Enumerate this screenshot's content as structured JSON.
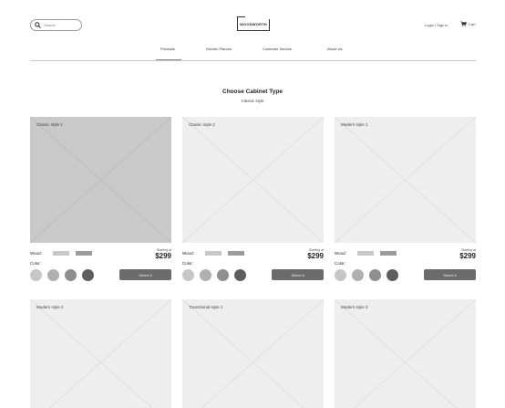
{
  "header": {
    "search_placeholder": "Search",
    "logo_text": "WOODWORTH",
    "login_label": "Login / Sign in",
    "cart_label": "Cart"
  },
  "nav": {
    "items": [
      "Products",
      "Kitchen Planner",
      "Customer Service",
      "About Us"
    ],
    "active": "Products"
  },
  "page": {
    "title": "Choose Cabinet Type",
    "subtitle": "Classic style"
  },
  "cards": [
    {
      "caption": "Classic style 1",
      "wood_label": "Wood:",
      "color_label": "Color:",
      "starting_label": "Starting at",
      "price": "$299",
      "button_label": "Select it"
    },
    {
      "caption": "Classic style 2",
      "wood_label": "Wood:",
      "color_label": "Color:",
      "starting_label": "Starting at",
      "price": "$299",
      "button_label": "Select it"
    },
    {
      "caption": "Modern style 1",
      "wood_label": "Wood:",
      "color_label": "Color:",
      "starting_label": "Starting at",
      "price": "$299",
      "button_label": "Select it"
    },
    {
      "caption": "Modern style 2"
    },
    {
      "caption": "Transitional style 1"
    },
    {
      "caption": "Modern style 3"
    }
  ],
  "colors": {
    "button": "#6b6b6b",
    "image_placeholder": "#eeeeee",
    "image_placeholder_selected": "#c9c9c9",
    "swatches": [
      "#c8c8c8",
      "#9c9c9c"
    ],
    "color_dots": [
      "#c6c6c6",
      "#b0b0b0",
      "#8e8e8e",
      "#5e5e5e"
    ]
  }
}
